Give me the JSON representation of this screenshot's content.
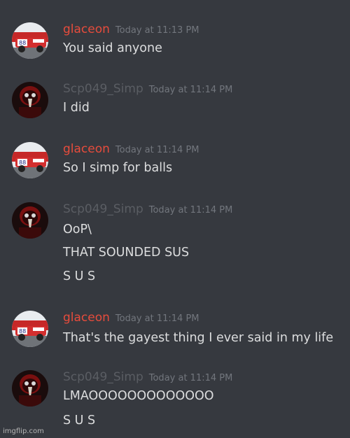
{
  "colors": {
    "background": "#36393f",
    "user_glaceon": "#e74c3c",
    "user_scp": "#5a5d63",
    "message_text": "#dcddde",
    "timestamp": "#72767d"
  },
  "messages": [
    {
      "username": "glaceon",
      "timestamp": "Today at 11:13 PM",
      "avatar_icon": "race-car-avatar-icon",
      "lines": [
        "You said anyone"
      ]
    },
    {
      "username": "Scp049_Simp",
      "timestamp": "Today at 11:14 PM",
      "avatar_icon": "plague-doctor-avatar-icon",
      "lines": [
        "I did"
      ]
    },
    {
      "username": "glaceon",
      "timestamp": "Today at 11:14 PM",
      "avatar_icon": "race-car-avatar-icon",
      "lines": [
        "So I simp for balls"
      ]
    },
    {
      "username": "Scp049_Simp",
      "timestamp": "Today at 11:14 PM",
      "avatar_icon": "plague-doctor-avatar-icon",
      "lines": [
        "OoP\\",
        "THAT SOUNDED SUS",
        "S U S"
      ]
    },
    {
      "username": "glaceon",
      "timestamp": "Today at 11:14 PM",
      "avatar_icon": "race-car-avatar-icon",
      "lines": [
        "That's the gayest thing I ever said in my life"
      ]
    },
    {
      "username": "Scp049_Simp",
      "timestamp": "Today at 11:14 PM",
      "avatar_icon": "plague-doctor-avatar-icon",
      "lines": [
        "LMAOOOOOOOOOOOOO",
        "S U S"
      ]
    }
  ],
  "watermark": "imgflip.com"
}
